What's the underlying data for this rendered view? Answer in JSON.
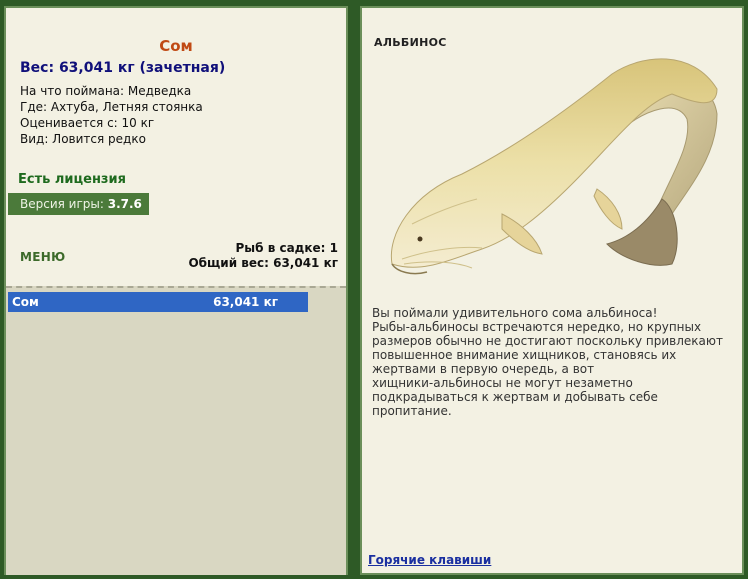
{
  "fish": {
    "name": "Сом",
    "weight_line": "Вес: 63,041 кг (зачетная)",
    "bait": "На что поймана: Медведка",
    "place": "Где: Ахтуба, Летняя стоянка",
    "rated_from": "Оценивается с: 10 кг",
    "kind": "Вид: Ловится редко"
  },
  "license": "Есть лицензия",
  "version": {
    "label": "Версия игры:",
    "value": "3.7.6"
  },
  "menu_label": "МЕНЮ",
  "keepnet": {
    "count": "Рыб в садке: 1",
    "total": "Общий вес: 63,041 кг",
    "items": [
      {
        "name": "Сом",
        "weight": "63,041 кг"
      }
    ]
  },
  "albino": {
    "title": "АЛЬБИНОС",
    "description": [
      "Вы поймали удивительного сома альбиноса!",
      "Рыбы-альбиносы встречаются нередко, но крупных",
      "размеров обычно не достигают поскольку привлекают",
      "повышенное внимание хищников, становясь их",
      "жертвами в первую очередь, а вот",
      "хищники-альбиносы не могут незаметно",
      "подкрадываться к жертвам и добывать себе",
      "пропитание."
    ]
  },
  "hotkeys_label": "Горячие клавиши",
  "colors": {
    "background": "#2e5a26",
    "panel": "#f3f1e3",
    "fish_name": "#c04a14",
    "weight": "#10107a",
    "license": "#1e6a1e",
    "selection": "#2f66c4",
    "link": "#1a2fa0"
  }
}
